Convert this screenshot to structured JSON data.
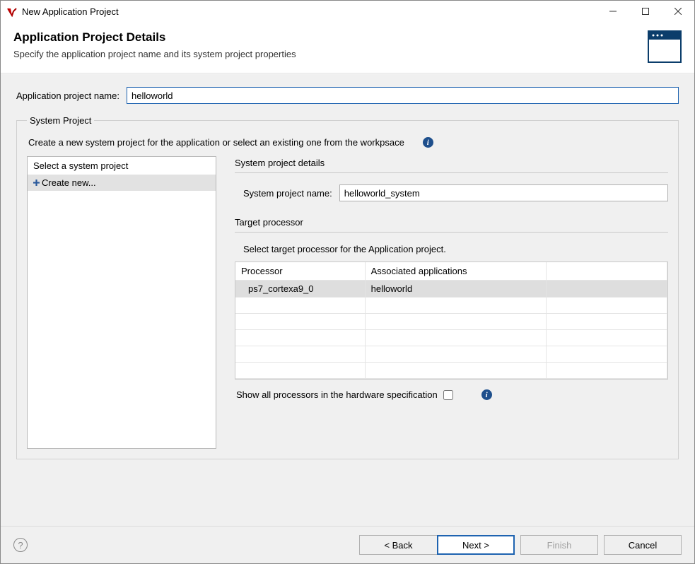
{
  "window": {
    "title": "New Application Project"
  },
  "header": {
    "title": "Application Project Details",
    "subtitle": "Specify the application project name and its system project properties"
  },
  "form": {
    "app_name_label": "Application project name:",
    "app_name_value": "helloworld"
  },
  "system_project": {
    "legend": "System Project",
    "hint": "Create a new system project for the application or select an existing one from the workpsace",
    "list_header": "Select a system project",
    "create_new_label": "Create new...",
    "details_title": "System project details",
    "name_label": "System project name:",
    "name_value": "helloworld_system",
    "target_title": "Target processor",
    "target_hint": "Select target processor for the Application project.",
    "table": {
      "col_processor": "Processor",
      "col_apps": "Associated applications",
      "rows": [
        {
          "processor": "ps7_cortexa9_0",
          "apps": "helloworld"
        }
      ]
    },
    "show_all_label": "Show all processors in the hardware specification"
  },
  "footer": {
    "back": "< Back",
    "next": "Next >",
    "finish": "Finish",
    "cancel": "Cancel"
  }
}
